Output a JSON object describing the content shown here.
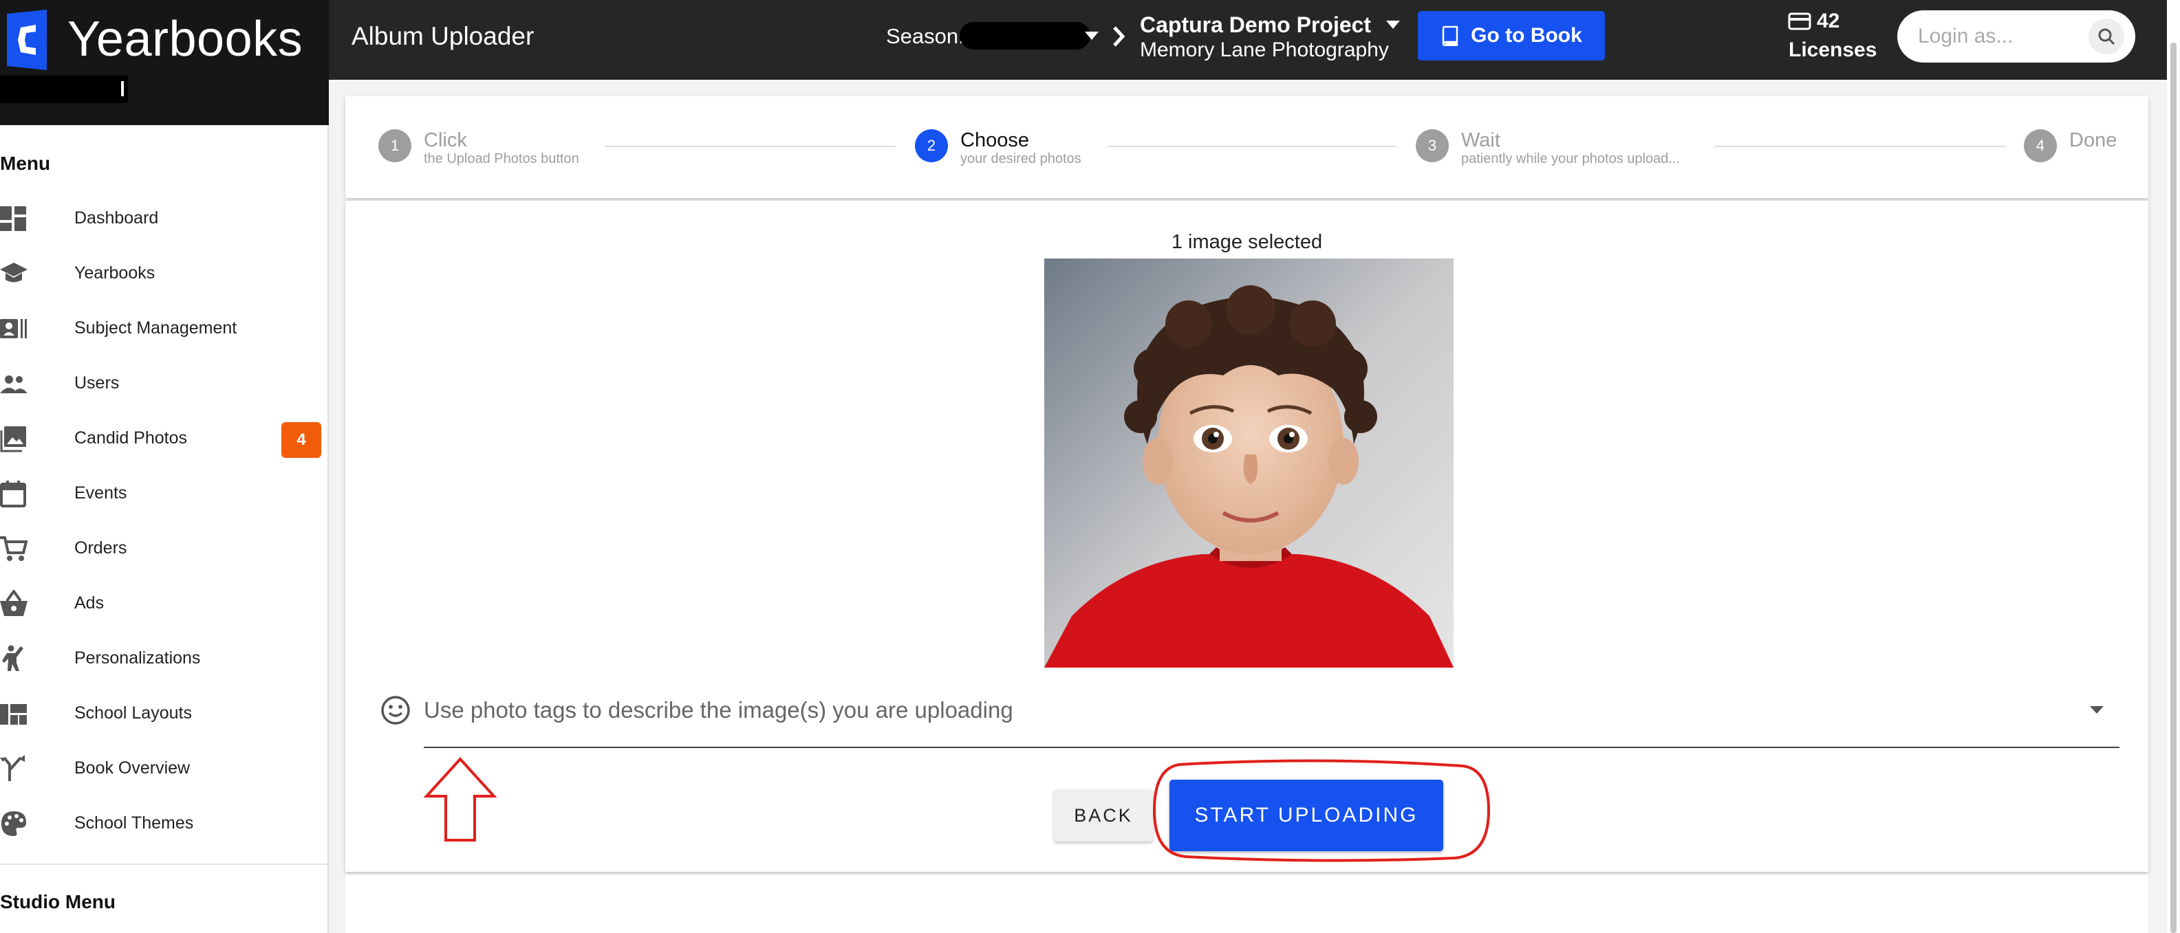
{
  "brand": {
    "name": "Yearbooks"
  },
  "header": {
    "app_title": "Album Uploader",
    "season_label": "Season:",
    "project_name": "Captura Demo Project",
    "studio_name": "Memory Lane Photography",
    "go_to_book_label": "Go to Book",
    "licenses_count": "42",
    "licenses_label": "Licenses",
    "login_placeholder": "Login as..."
  },
  "sidebar": {
    "menu_title": "Menu",
    "items": [
      {
        "label": "Dashboard",
        "icon": "dashboard-icon"
      },
      {
        "label": "Yearbooks",
        "icon": "graduation-cap-icon"
      },
      {
        "label": "Subject Management",
        "icon": "contact-card-icon"
      },
      {
        "label": "Users",
        "icon": "people-icon"
      },
      {
        "label": "Candid Photos",
        "icon": "photo-library-icon",
        "badge": "4"
      },
      {
        "label": "Events",
        "icon": "calendar-icon"
      },
      {
        "label": "Orders",
        "icon": "cart-icon"
      },
      {
        "label": "Ads",
        "icon": "basket-icon"
      },
      {
        "label": "Personalizations",
        "icon": "person-wave-icon"
      },
      {
        "label": "School Layouts",
        "icon": "layout-icon"
      },
      {
        "label": "Book Overview",
        "icon": "merge-icon"
      },
      {
        "label": "School Themes",
        "icon": "palette-icon"
      }
    ],
    "studio_menu_title": "Studio Menu"
  },
  "stepper": {
    "steps": [
      {
        "number": "1",
        "title": "Click",
        "subtitle": "the Upload Photos button"
      },
      {
        "number": "2",
        "title": "Choose",
        "subtitle": "your desired photos"
      },
      {
        "number": "3",
        "title": "Wait",
        "subtitle": "patiently while your photos upload..."
      },
      {
        "number": "4",
        "title": "Done",
        "subtitle": ""
      }
    ],
    "active_step": 2
  },
  "uploader": {
    "selected_count_text": "1 image selected",
    "tags_placeholder": "Use photo tags to describe the image(s) you are uploading",
    "back_label": "BACK",
    "start_label": "START UPLOADING"
  },
  "colors": {
    "accent": "#1652f0",
    "badge": "#f25b0a",
    "annotation": "#e0201c",
    "topbar": "#262626"
  }
}
